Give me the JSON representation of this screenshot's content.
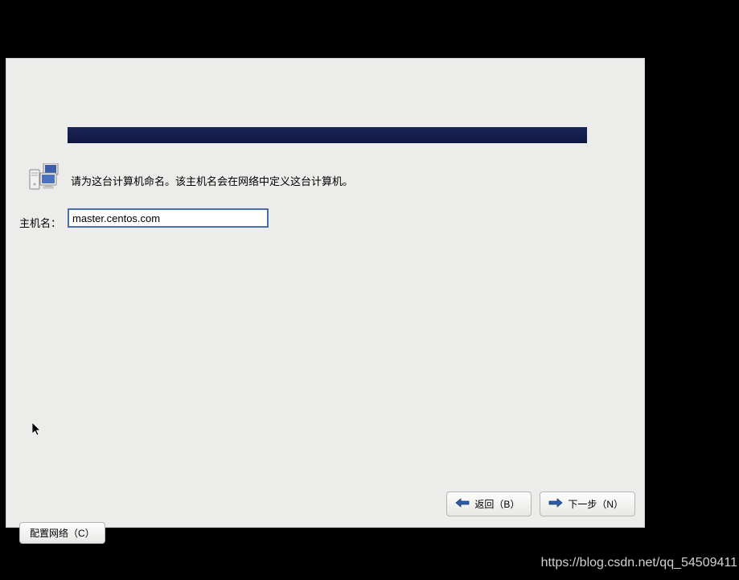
{
  "instruction": "请为这台计算机命名。该主机名会在网络中定义这台计算机。",
  "hostname": {
    "label": "主机名：",
    "value": "master.centos.com"
  },
  "buttons": {
    "configure_network": "配置网络（C）",
    "back": "返回（B）",
    "next": "下一步（N）"
  },
  "watermark": "https://blog.csdn.net/qq_54509411"
}
